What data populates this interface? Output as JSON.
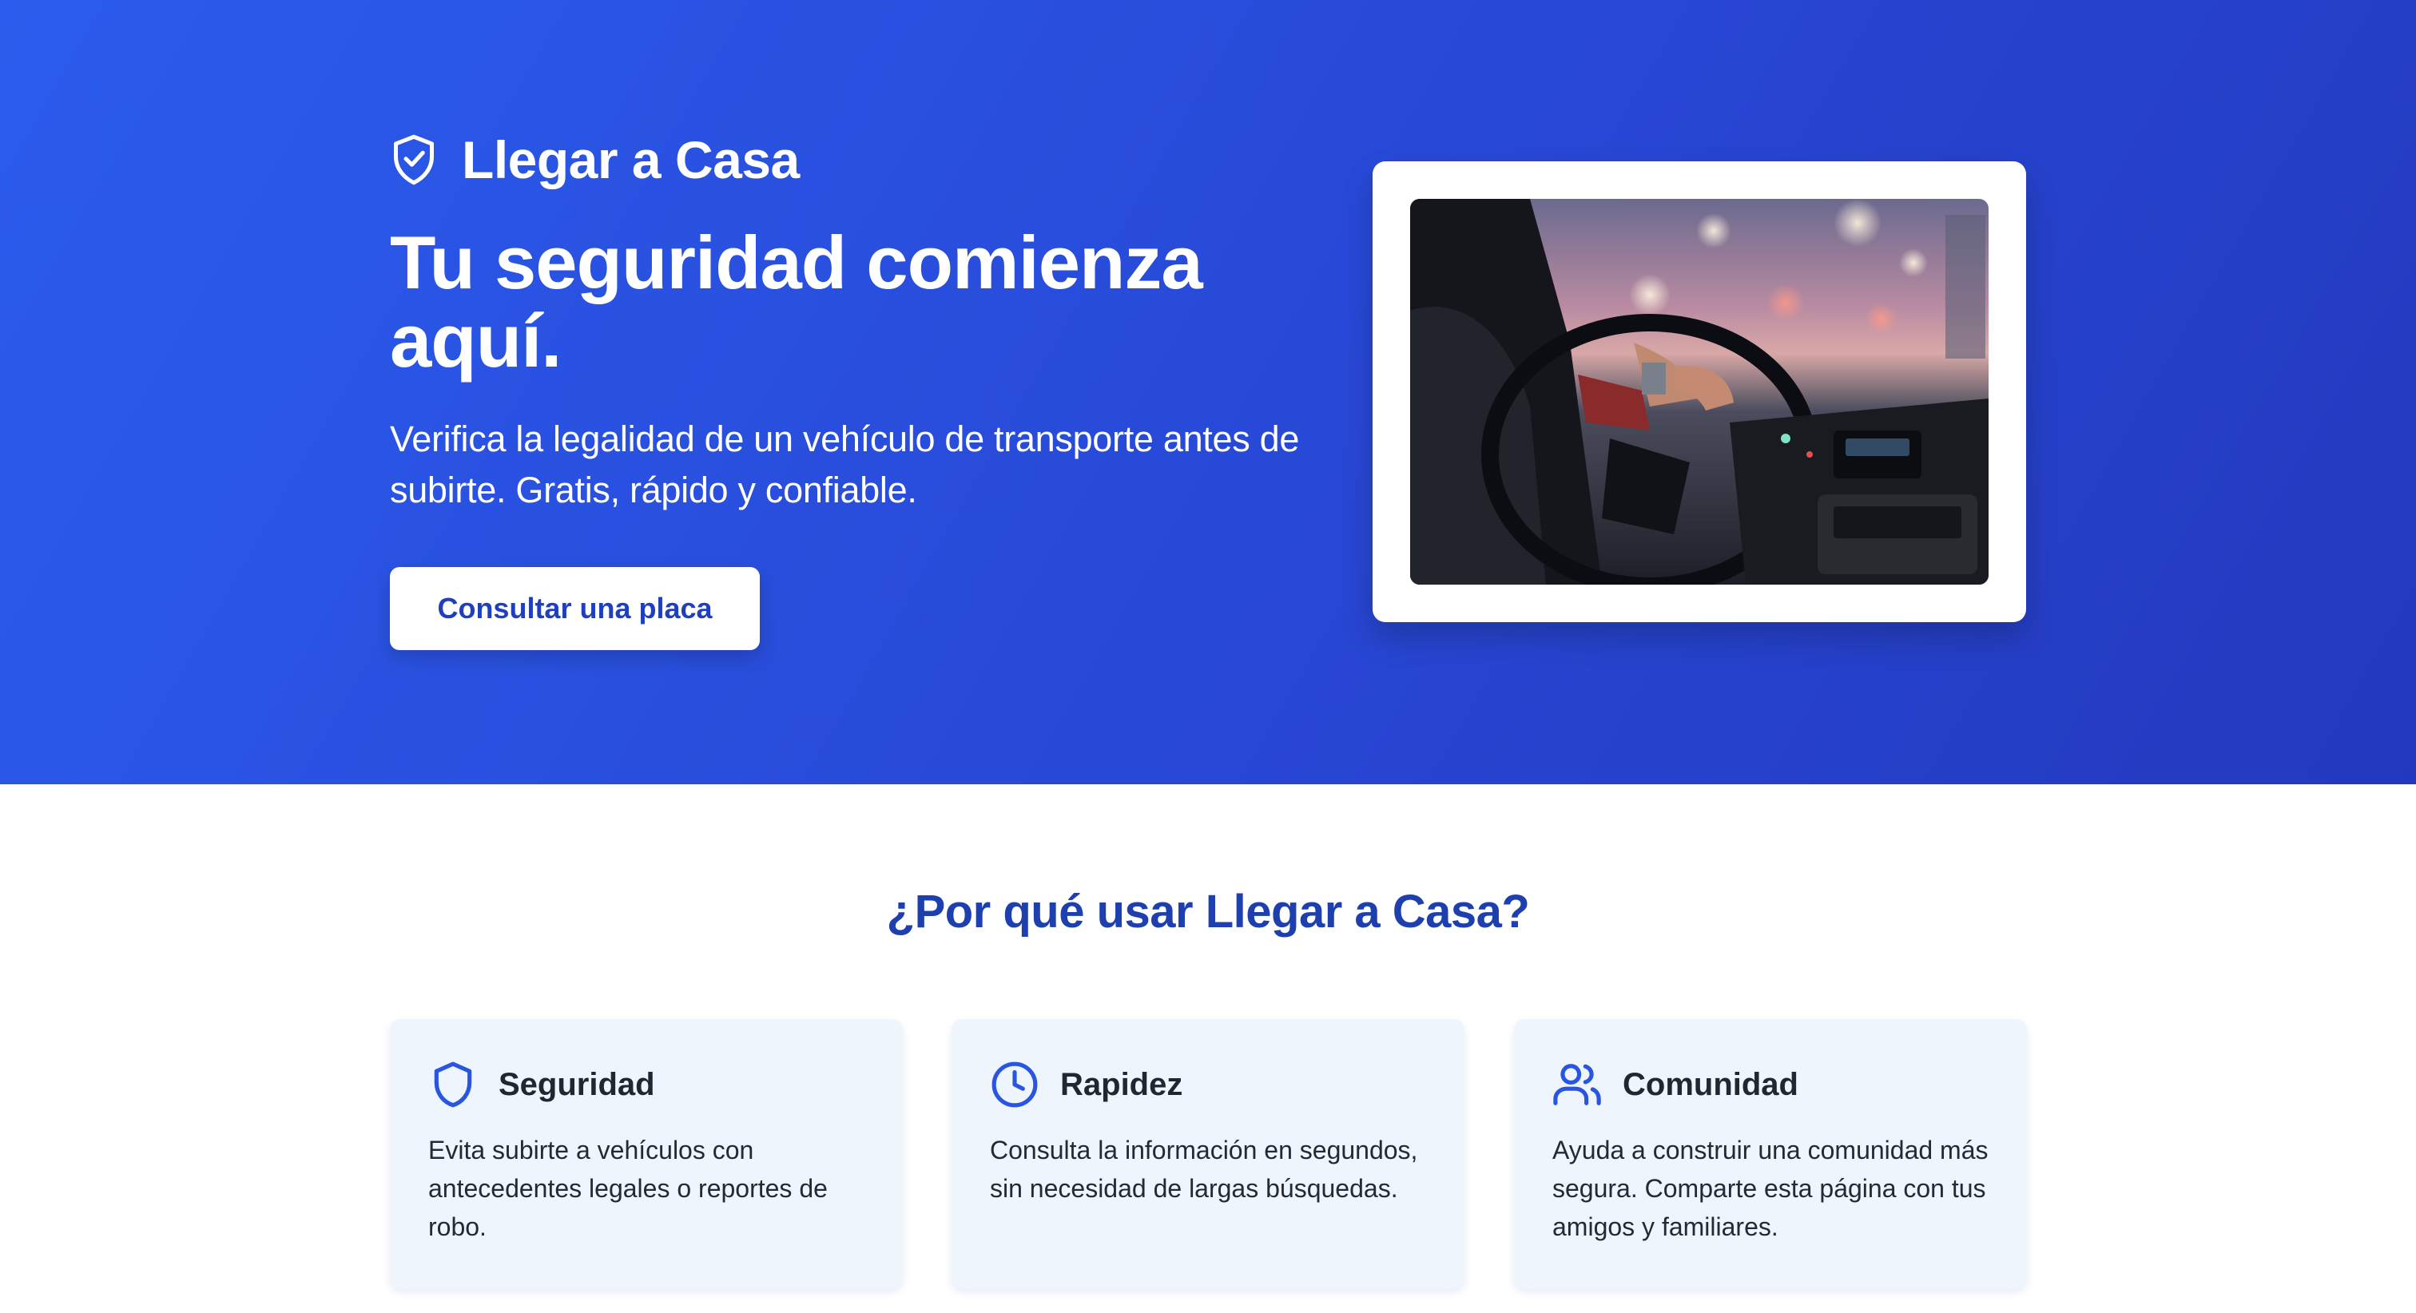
{
  "hero": {
    "brand_name": "Llegar a Casa",
    "headline": "Tu seguridad comienza aquí.",
    "subtitle": "Verifica la legalidad de un vehículo de transporte antes de subirte. Gratis, rápido y confiable.",
    "cta_label": "Consultar una placa",
    "image_icon": "car-interior-photo"
  },
  "features": {
    "title": "¿Por qué usar Llegar a Casa?",
    "cards": [
      {
        "icon": "shield-icon",
        "title": "Seguridad",
        "text": "Evita subirte a vehículos con antecedentes legales o reportes de robo."
      },
      {
        "icon": "clock-icon",
        "title": "Rapidez",
        "text": "Consulta la información en segundos, sin necesidad de largas búsquedas."
      },
      {
        "icon": "users-icon",
        "title": "Comunidad",
        "text": "Ayuda a construir una comunidad más segura. Comparte esta página con tus amigos y familiares."
      }
    ]
  },
  "colors": {
    "hero_start": "#2b5ced",
    "hero_end": "#2339bd",
    "accent": "#1e3fae",
    "card_bg": "#eff5fd",
    "icon_blue": "#2a55e0"
  }
}
